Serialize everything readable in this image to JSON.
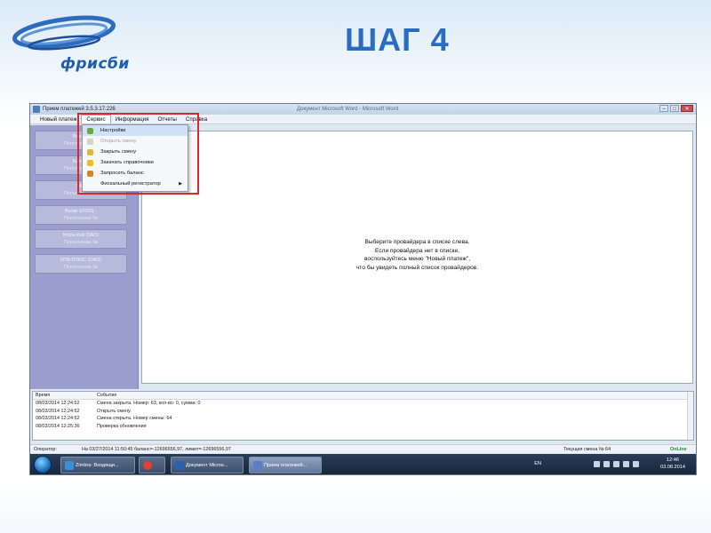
{
  "slide": {
    "logo_text": "фрисби",
    "title": "ШАГ 4"
  },
  "window": {
    "title": "Прием платежей 3.5.3.17.226",
    "title_right": "Документ Microsoft Word - Microsoft Word",
    "controls": {
      "minimize": "–",
      "maximize": "□",
      "close": "✕"
    }
  },
  "menubar": {
    "items": [
      {
        "label": "Новый платеж"
      },
      {
        "label": "Сервис"
      },
      {
        "label": "Информация"
      },
      {
        "label": "Отчеты"
      },
      {
        "label": "Справка"
      }
    ]
  },
  "dropdown": {
    "items": [
      {
        "label": "Настройки",
        "icon": "settings-icon"
      },
      {
        "label": "Открыть смену",
        "icon": "open-shift-icon"
      },
      {
        "label": "Закрыть смену",
        "icon": "close-shift-icon"
      },
      {
        "label": "Закачать справочники",
        "icon": "download-icon"
      },
      {
        "label": "Запросить баланс",
        "icon": "balance-icon"
      },
      {
        "label": "Фискальный регистратор",
        "icon": ""
      }
    ],
    "submenu_arrow": "▶"
  },
  "providers": [
    {
      "name": "Beeline",
      "sub": "Пополнение №"
    },
    {
      "name": "Билайн",
      "sub": "Пополнение №"
    },
    {
      "name": "ЗАО",
      "sub": "Пополнение №"
    },
    {
      "name": "Внокс (ООО) -",
      "sub": "Пополнение №"
    },
    {
      "name": "Мора Кей (ЗАО)",
      "sub": "Пополнение №"
    },
    {
      "name": "ИТВ-ПЛЮС (ОАО)",
      "sub": "Пополнение №"
    }
  ],
  "hint": {
    "line1": "Выберите провайдера в списке слева.",
    "line2": "Если провайдера нет в списке,",
    "line3": "воспользуйтесь меню \"Новый платеж\",",
    "line4": "что бы увидеть полный список провайдеров."
  },
  "log": {
    "headers": {
      "time": "Время",
      "event": "Событие"
    },
    "rows": [
      {
        "time": "08/03/2014 12:24:52",
        "event": "Смена закрыта. Номер: 63, кол-во: 0, сумма: 0"
      },
      {
        "time": "08/03/2014 12:24:52",
        "event": "Открыть смену."
      },
      {
        "time": "08/03/2014 12:24:52",
        "event": "Смена открыта. Номер смены: 64"
      },
      {
        "time": "08/03/2014 12:25:36",
        "event": "Проверка обновления"
      }
    ]
  },
  "statusbar": {
    "operator_label": "Оператор:",
    "balance": "На 03/27/2014 11:50:45 баланс=-12696556,97, лимит=-12696556,97",
    "shift": "Текущая смена № 64",
    "online": "OnLine"
  },
  "taskbar": {
    "tasks": [
      {
        "label": "Zimbra: Входящи..."
      },
      {
        "label": ""
      },
      {
        "label": "Документ Micros..."
      },
      {
        "label": "Прием платежей..."
      }
    ],
    "lang": "EN",
    "time": "12:46",
    "date": "03.08.2014"
  },
  "colors": {
    "accent": "#2a6cc0",
    "highlight_border": "#e0252a",
    "left_panel": "#9a9ece",
    "online": "#1f8a2f"
  }
}
